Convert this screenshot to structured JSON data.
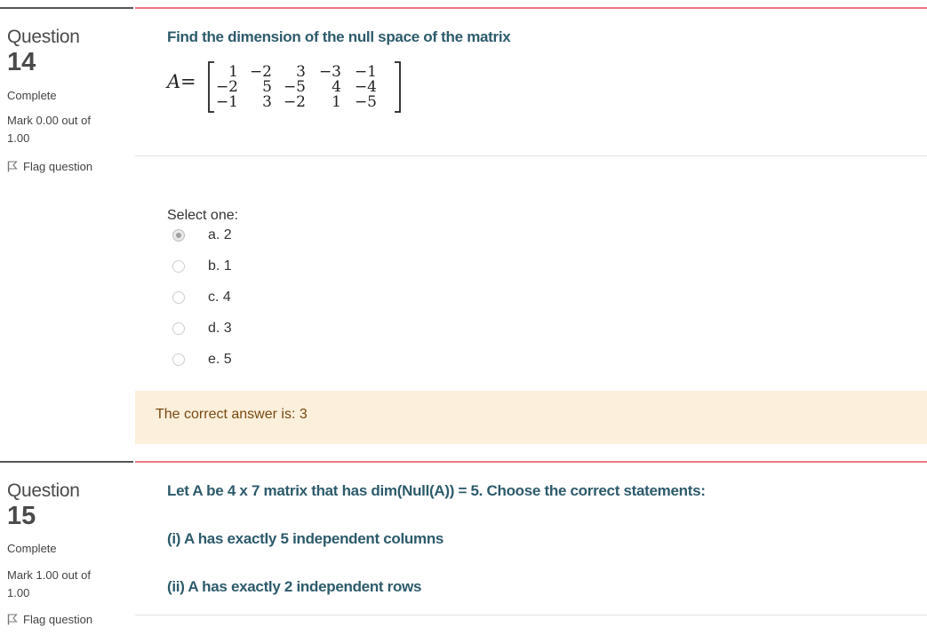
{
  "questions": [
    {
      "label": "Question",
      "number": "14",
      "state": "Complete",
      "grade": "Mark 0.00 out of 1.00",
      "flag_label": "Flag question",
      "text": "Find the dimension of the null space of the matrix",
      "matrix": {
        "name": "A",
        "rows": [
          [
            "1",
            "−2",
            "3",
            "−3",
            "−1"
          ],
          [
            "−2",
            "5",
            "−5",
            "4",
            "−4"
          ],
          [
            "−1",
            "3",
            "−2",
            "1",
            "−5"
          ]
        ]
      },
      "prompt": "Select one:",
      "options": [
        {
          "label": "a. 2",
          "selected": true
        },
        {
          "label": "b. 1",
          "selected": false
        },
        {
          "label": "c. 4",
          "selected": false
        },
        {
          "label": "d. 3",
          "selected": false
        },
        {
          "label": "e. 5",
          "selected": false
        }
      ],
      "feedback": "The correct answer is: 3"
    },
    {
      "label": "Question",
      "number": "15",
      "state": "Complete",
      "grade": "Mark 1.00 out of 1.00",
      "flag_label": "Flag question",
      "text_lines": [
        "Let A be 4 x 7 matrix that has dim(Null(A)) = 5. Choose the correct statements:",
        "(i) A has exactly 5 independent columns",
        "(ii) A has exactly 2 independent rows"
      ]
    }
  ],
  "colors": {
    "question_text": "#2d5b6b",
    "accent_line": "#ea7a85",
    "feedback_bg": "#fcefdc",
    "feedback_text": "#7a4a13"
  }
}
